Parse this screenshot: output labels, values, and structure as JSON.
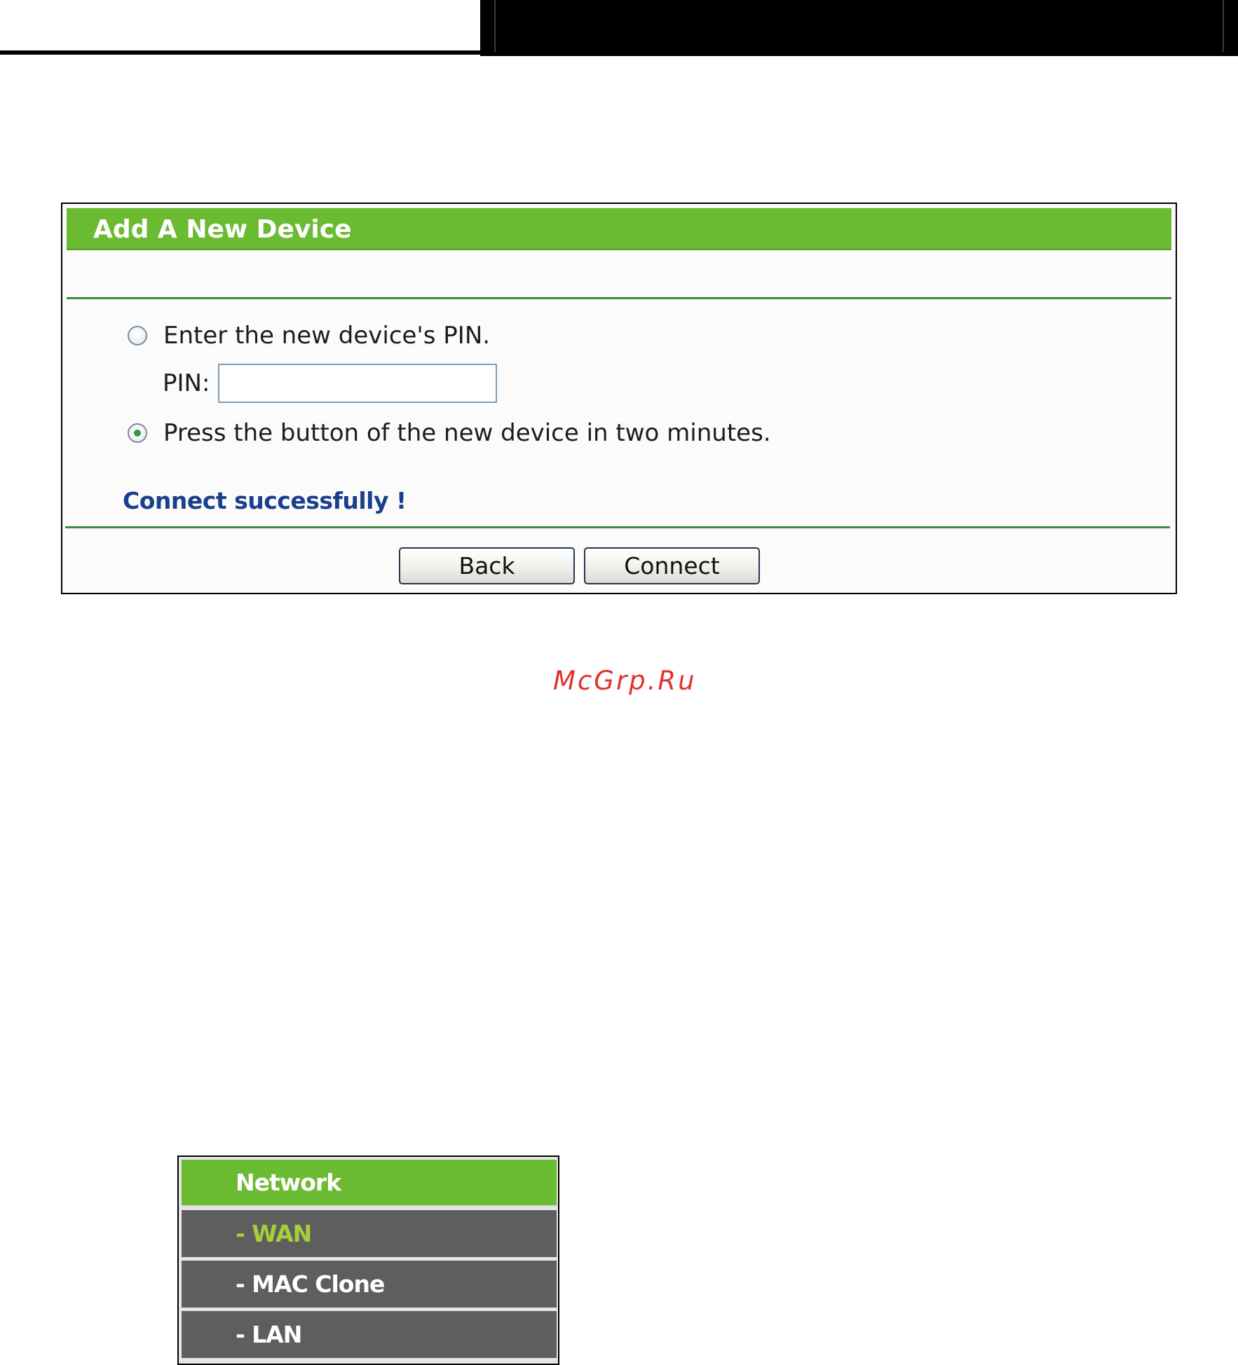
{
  "dialog": {
    "title": "Add A New Device",
    "option_pin_label": "Enter the new device's PIN.",
    "pin_field_label": "PIN:",
    "pin_value": "",
    "option_button_label": "Press the button of the new device in two minutes.",
    "selected_option": "button",
    "status_message": "Connect successfully !",
    "back_label": "Back",
    "connect_label": "Connect"
  },
  "watermark": {
    "text": "McGrp.Ru"
  },
  "nav_menu": {
    "header": "Network",
    "items": [
      {
        "label": "- WAN",
        "active": true
      },
      {
        "label": "- MAC Clone",
        "active": false
      },
      {
        "label": "- LAN",
        "active": false
      }
    ]
  },
  "colors": {
    "header_green": "#6bbb32",
    "status_blue": "#1a3f8c",
    "menu_gray": "#5e5e5e",
    "menu_active_text": "#a4cf3a",
    "watermark_red": "#e0322f"
  }
}
